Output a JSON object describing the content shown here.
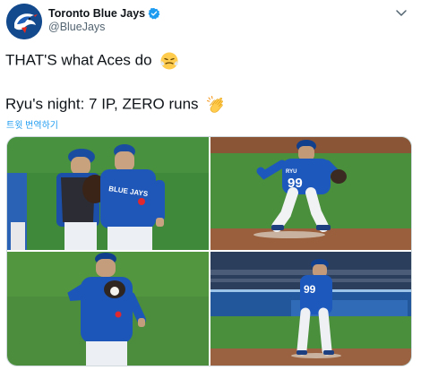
{
  "account": {
    "display_name": "Toronto Blue Jays",
    "handle": "@BlueJays",
    "verified": true,
    "avatar": "blue-jays-logo"
  },
  "tweet": {
    "line1": "THAT'S what Aces do",
    "line1_emoji": "face-with-steam-emoji",
    "line2": "Ryu's night: 7 IP, ZERO runs",
    "line2_emoji": "clapping-hands-emoji",
    "translate_label": "트윗 번역하기"
  },
  "media": {
    "photos": [
      {
        "subject": "catcher-and-pitcher-conference",
        "jersey_text": "BLUE JAYS"
      },
      {
        "subject": "pitcher-wind-up",
        "jersey_number": "99",
        "name_text": "RYU"
      },
      {
        "subject": "pitcher-receiving-ball"
      },
      {
        "subject": "pitcher-on-mound-stadium",
        "jersey_number": "99"
      }
    ]
  },
  "colors": {
    "brand_blue": "#134a8e",
    "link": "#1d9bf0",
    "verified": "#1d9bf0",
    "muted": "#536471"
  }
}
